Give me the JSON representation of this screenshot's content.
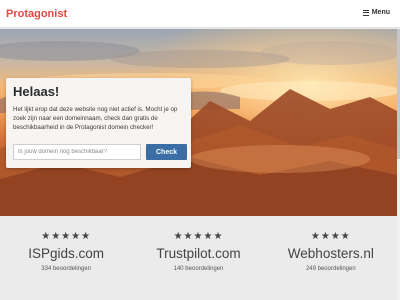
{
  "header": {
    "logo": "Protagonist",
    "menu_label": "Menu"
  },
  "hero": {
    "title": "Helaas!",
    "text": "Het lijkt erop dat deze website nog niet actief is. Mocht je op zoek zijn naar een domeinnaam, check dan gratis de beschikbaarheid in de Protagonist domein checker!",
    "input_placeholder": "Is jouw domein nog beschikbaar?",
    "button_label": "Check"
  },
  "reviews": [
    {
      "stars": "★★★★★",
      "site": "ISPgids.com",
      "count": "334 beoordelingen"
    },
    {
      "stars": "★★★★★",
      "site": "Trustpilot.com",
      "count": "140 beoordelingen"
    },
    {
      "stars": "★★★★",
      "site": "Webhosters.nl",
      "count": "249 beoordelingen"
    }
  ],
  "colors": {
    "brand": "#e8463f",
    "button": "#3a6ea5"
  }
}
